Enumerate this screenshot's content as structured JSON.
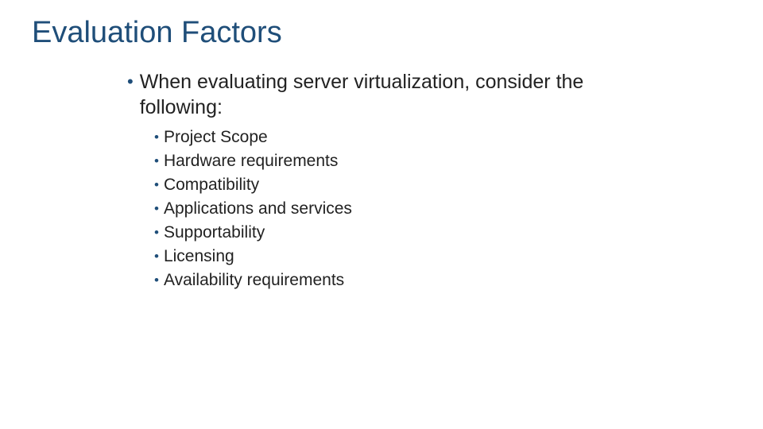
{
  "slide": {
    "title": "Evaluation Factors",
    "main_bullet": "When evaluating server virtualization, consider the following:",
    "sub_bullets": [
      "Project Scope",
      "Hardware requirements",
      "Compatibility",
      "Applications and services",
      "Supportability",
      "Licensing",
      "Availability requirements"
    ]
  }
}
